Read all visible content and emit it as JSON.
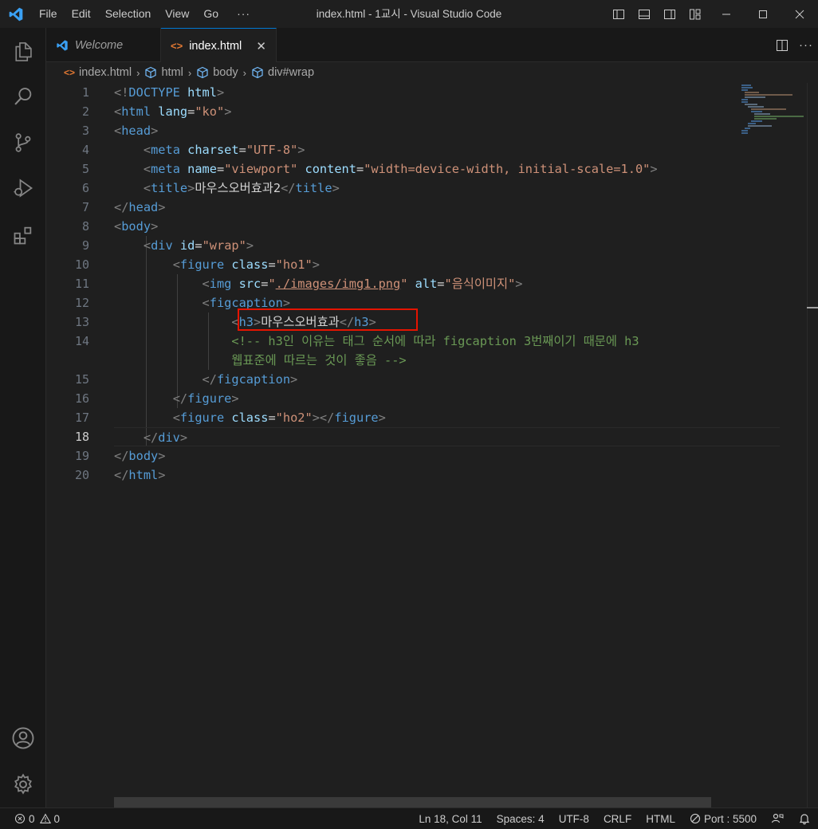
{
  "titlebar": {
    "menu": [
      "File",
      "Edit",
      "Selection",
      "View",
      "Go"
    ],
    "more": "···",
    "title": "index.html - 1교시 - Visual Studio Code"
  },
  "tabs": [
    {
      "label": "Welcome",
      "active": false
    },
    {
      "label": "index.html",
      "active": true,
      "close": "✕"
    }
  ],
  "breadcrumb": {
    "items": [
      "index.html",
      "html",
      "body",
      "div#wrap"
    ]
  },
  "editor": {
    "current_line": 18,
    "line_numbers": [
      "1",
      "2",
      "3",
      "4",
      "5",
      "6",
      "7",
      "8",
      "9",
      "10",
      "11",
      "12",
      "13",
      "14",
      "",
      "15",
      "16",
      "17",
      "18",
      "19",
      "20"
    ]
  },
  "code": {
    "l1": {
      "a": "<!",
      "b": "DOCTYPE",
      "c": " html",
      "d": ">"
    },
    "l2": {
      "a": "<",
      "b": "html",
      "c": " lang",
      "d": "=",
      "e": "\"ko\"",
      "f": ">"
    },
    "l3": {
      "a": "<",
      "b": "head",
      "c": ">"
    },
    "l4": {
      "a": "<",
      "b": "meta",
      "c": " charset",
      "d": "=",
      "e": "\"UTF-8\"",
      "f": ">"
    },
    "l5": {
      "a": "<",
      "b": "meta",
      "c": " name",
      "d": "=",
      "e": "\"viewport\"",
      "f": " content",
      "g": "=",
      "h": "\"width=device-width, initial-scale=1.0\"",
      "i": ">"
    },
    "l6": {
      "a": "<",
      "b": "title",
      "c": ">",
      "d": "마우스오버효과2",
      "e": "</",
      "f": "title",
      "g": ">"
    },
    "l7": {
      "a": "</",
      "b": "head",
      "c": ">"
    },
    "l8": {
      "a": "<",
      "b": "body",
      "c": ">"
    },
    "l9": {
      "a": "<",
      "b": "div",
      "c": " id",
      "d": "=",
      "e": "\"wrap\"",
      "f": ">"
    },
    "l10": {
      "a": "<",
      "b": "figure",
      "c": " class",
      "d": "=",
      "e": "\"ho1\"",
      "f": ">"
    },
    "l11": {
      "a": "<",
      "b": "img",
      "c": " src",
      "d": "=",
      "e1": "\"",
      "e2": "./images/img1.png",
      "e3": "\"",
      "f": " alt",
      "g": "=",
      "h": "\"음식이미지\"",
      "i": ">"
    },
    "l12": {
      "a": "<",
      "b": "figcaption",
      "c": ">"
    },
    "l13": {
      "a": "<",
      "b": "h3",
      "c": ">",
      "d": "마우스오버효과",
      "e": "</",
      "f": "h3",
      "g": ">"
    },
    "l14a": "<!-- h3인 이유는 태그 순서에 따라 figcaption 3번째이기 때문에 h3",
    "l14b": "웹표준에 따르는 것이 좋음 -->",
    "l15": {
      "a": "</",
      "b": "figcaption",
      "c": ">"
    },
    "l16": {
      "a": "</",
      "b": "figure",
      "c": ">"
    },
    "l17": {
      "a": "<",
      "b": "figure",
      "c": " class",
      "d": "=",
      "e": "\"ho2\"",
      "f": "></",
      "g": "figure",
      "h": ">"
    },
    "l18": {
      "a": "</",
      "b": "div",
      "c": ">"
    },
    "l19": {
      "a": "</",
      "b": "body",
      "c": ">"
    },
    "l20": {
      "a": "</",
      "b": "html",
      "c": ">"
    }
  },
  "statusbar": {
    "errors": "0",
    "warnings": "0",
    "position": "Ln 18, Col 11",
    "spaces": "Spaces: 4",
    "encoding": "UTF-8",
    "eol": "CRLF",
    "language": "HTML",
    "port": "Port : 5500"
  },
  "colors": {
    "accent": "#0078d4",
    "highlight_box": "#e51400",
    "tag": "#569cd6",
    "attribute": "#9cdcfe",
    "string": "#ce9178",
    "comment": "#6a9955"
  },
  "icons": [
    "vscode-logo",
    "explorer-icon",
    "search-icon",
    "source-control-icon",
    "run-debug-icon",
    "extensions-icon",
    "accounts-icon",
    "manage-gear-icon"
  ]
}
